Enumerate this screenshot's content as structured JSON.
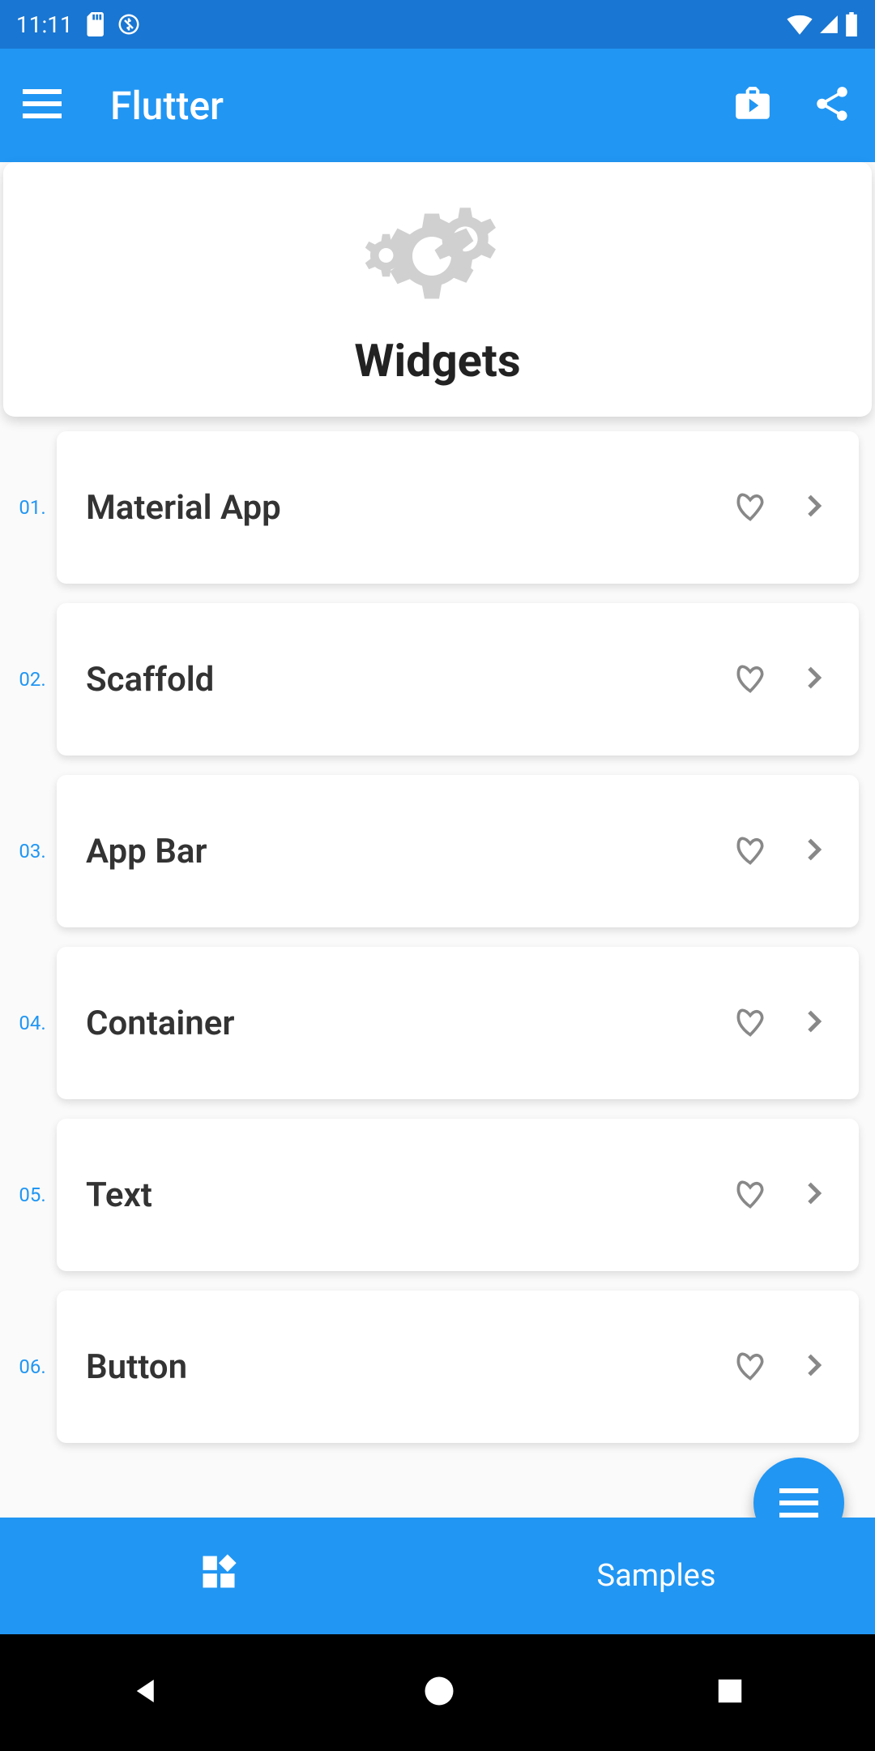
{
  "status": {
    "time": "11:11"
  },
  "appbar": {
    "title": "Flutter"
  },
  "hero": {
    "title": "Widgets"
  },
  "widgets": [
    {
      "num": "01.",
      "label": "Material App"
    },
    {
      "num": "02.",
      "label": "Scaffold"
    },
    {
      "num": "03.",
      "label": "App Bar"
    },
    {
      "num": "04.",
      "label": "Container"
    },
    {
      "num": "05.",
      "label": "Text"
    },
    {
      "num": "06.",
      "label": "Button"
    }
  ],
  "tabs": {
    "samples": "Samples"
  }
}
